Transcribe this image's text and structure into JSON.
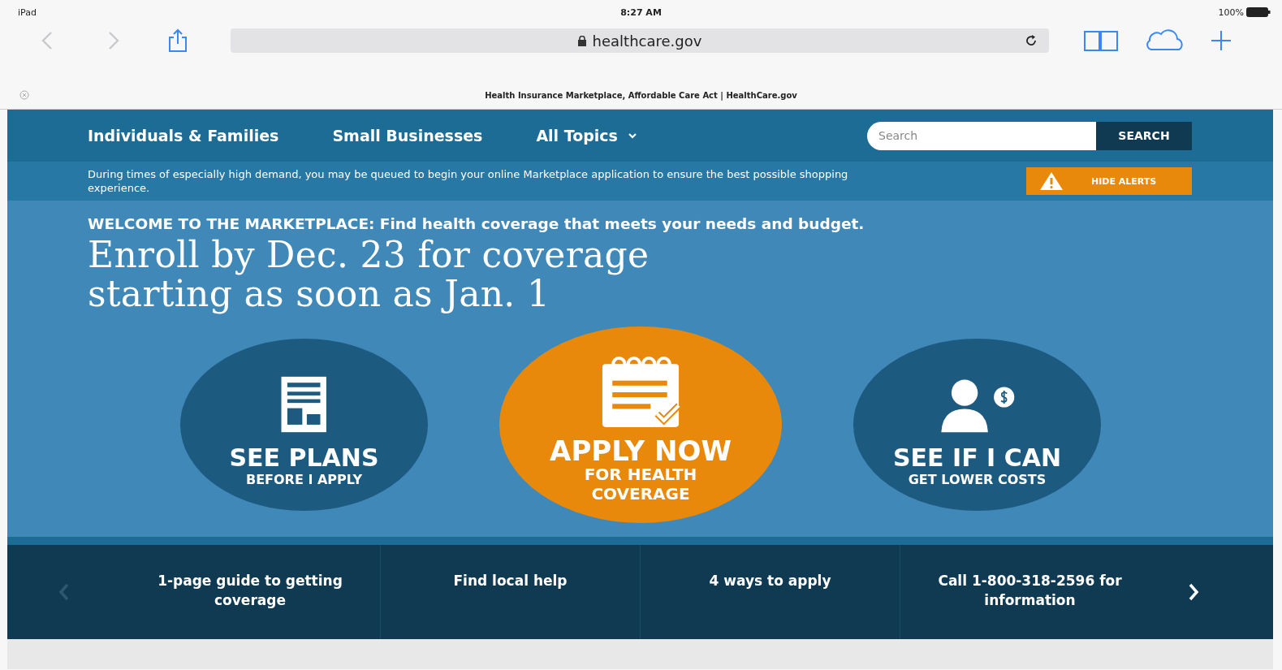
{
  "status_bar": {
    "device": "iPad",
    "time": "8:27 AM",
    "battery": "100%"
  },
  "browser": {
    "url": "healthcare.gov",
    "page_title": "Health Insurance Marketplace, Affordable Care Act | HealthCare.gov"
  },
  "nav": {
    "items": [
      {
        "label": "Individuals & Families",
        "kind": "link"
      },
      {
        "label": "Small Businesses",
        "kind": "link"
      },
      {
        "label": "All Topics",
        "kind": "dropdown"
      }
    ],
    "search": {
      "placeholder": "Search",
      "button": "SEARCH"
    }
  },
  "alert": {
    "text": "During times of especially high demand, you may be queued to begin your online Marketplace application to ensure the best possible shopping experience.",
    "button": "HIDE ALERTS"
  },
  "hero": {
    "kicker": "WELCOME TO THE MARKETPLACE: Find health coverage that meets your needs and budget.",
    "headline": "Enroll by Dec. 23 for coverage starting as soon as Jan. 1",
    "actions": [
      {
        "kind": "plans",
        "title": "SEE PLANS",
        "subtitle": "BEFORE I APPLY",
        "featured": false
      },
      {
        "kind": "apply",
        "title": "APPLY NOW",
        "subtitle": "FOR HEALTH COVERAGE",
        "featured": true
      },
      {
        "kind": "costs",
        "title": "SEE IF I CAN",
        "subtitle": "GET LOWER COSTS",
        "featured": false
      }
    ]
  },
  "quick_links": {
    "prev_disabled": true,
    "next_disabled": false,
    "items": [
      "1-page guide to getting coverage",
      "Find local help",
      "4 ways to apply",
      "Call 1-800-318-2596 for information"
    ]
  }
}
